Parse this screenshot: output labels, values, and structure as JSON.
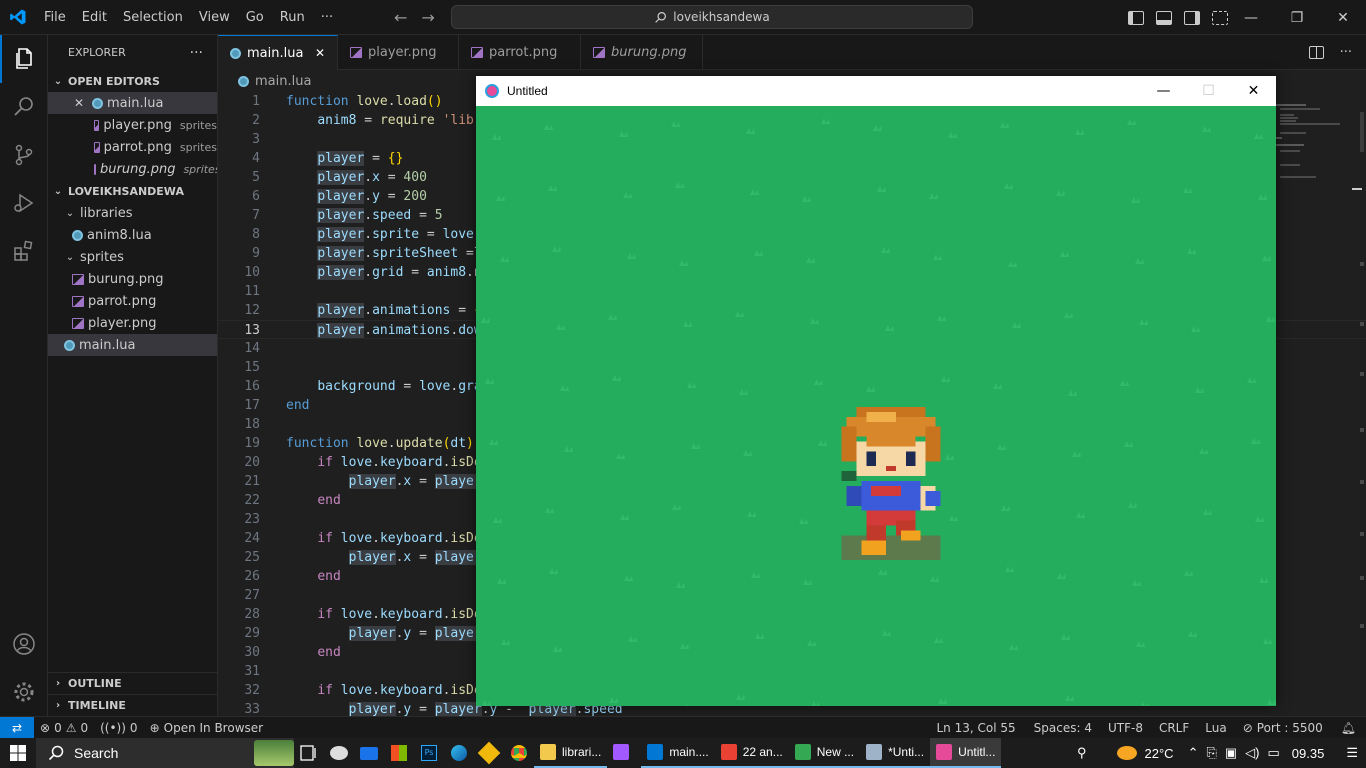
{
  "menu": [
    "File",
    "Edit",
    "Selection",
    "View",
    "Go",
    "Run",
    "···"
  ],
  "command_center": "loveikhsandewa",
  "explorer": {
    "title": "EXPLORER",
    "more": "···",
    "open_editors_label": "OPEN EDITORS",
    "open_editors": [
      {
        "label": "main.lua",
        "desc": "",
        "type": "lua",
        "close": "✕"
      },
      {
        "label": "player.png",
        "desc": "sprites",
        "type": "png"
      },
      {
        "label": "parrot.png",
        "desc": "sprites",
        "type": "png"
      },
      {
        "label": "burung.png",
        "desc": "sprites",
        "type": "png",
        "italic": true
      }
    ],
    "project_label": "LOVEIKHSANDEWA",
    "tree": [
      {
        "label": "libraries",
        "type": "folder"
      },
      {
        "label": "anim8.lua",
        "type": "lua"
      },
      {
        "label": "sprites",
        "type": "folder"
      },
      {
        "label": "burung.png",
        "type": "png"
      },
      {
        "label": "parrot.png",
        "type": "png"
      },
      {
        "label": "player.png",
        "type": "png"
      },
      {
        "label": "main.lua",
        "type": "lua"
      }
    ],
    "outline_label": "OUTLINE",
    "timeline_label": "TIMELINE"
  },
  "tabs": [
    {
      "label": "main.lua",
      "type": "lua",
      "close": "✕",
      "active": true
    },
    {
      "label": "player.png",
      "type": "png"
    },
    {
      "label": "parrot.png",
      "type": "png"
    },
    {
      "label": "burung.png",
      "type": "png",
      "italic": true
    }
  ],
  "breadcrumb": "main.lua",
  "code_lines": [
    {
      "n": 1,
      "html": "<span class='kb'>function</span> <span class='fn'>love</span>.<span class='fn'>load</span><span class='br'>()</span>"
    },
    {
      "n": 2,
      "html": "    <span class='var'>anim8</span> = <span class='fn'>require</span> <span class='str'>'libr</span>"
    },
    {
      "n": 3,
      "html": ""
    },
    {
      "n": 4,
      "html": "    <span class='var hl'>player</span> = <span class='br'>{}</span>"
    },
    {
      "n": 5,
      "html": "    <span class='var hl'>player</span>.<span class='var'>x</span> = <span class='num'>400</span>"
    },
    {
      "n": 6,
      "html": "    <span class='var hl'>player</span>.<span class='var'>y</span> = <span class='num'>200</span>"
    },
    {
      "n": 7,
      "html": "    <span class='var hl'>player</span>.<span class='var'>speed</span> = <span class='num'>5</span>"
    },
    {
      "n": 8,
      "html": "    <span class='var hl'>player</span>.<span class='var'>sprite</span> = <span class='var'>love</span>."
    },
    {
      "n": 9,
      "html": "    <span class='var hl'>player</span>.<span class='var'>spriteSheet</span> =l"
    },
    {
      "n": 10,
      "html": "    <span class='var hl'>player</span>.<span class='var'>grid</span> = <span class='var'>anim8</span>.n"
    },
    {
      "n": 11,
      "html": ""
    },
    {
      "n": 12,
      "html": "    <span class='var hl'>player</span>.<span class='var'>animations</span> = <span class='br'>{</span>"
    },
    {
      "n": 13,
      "html": "    <span class='var hl'>player</span>.<span class='var'>animations</span>.<span class='var'>dow</span>",
      "current": true
    },
    {
      "n": 14,
      "html": ""
    },
    {
      "n": 15,
      "html": ""
    },
    {
      "n": 16,
      "html": "    <span class='var'>background</span> = <span class='var'>love</span>.<span class='var'>gra</span>"
    },
    {
      "n": 17,
      "html": "<span class='kb'>end</span>"
    },
    {
      "n": 18,
      "html": ""
    },
    {
      "n": 19,
      "html": "<span class='kb'>function</span> <span class='fn'>love</span>.<span class='fn'>update</span><span class='br'>(</span><span class='var'>dt</span><span class='br'>)</span>"
    },
    {
      "n": 20,
      "html": "    <span class='kw'>if</span> <span class='var'>love</span>.<span class='var'>keyboard</span>.<span class='fn'>isDo</span>"
    },
    {
      "n": 21,
      "html": "        <span class='var hl'>player</span>.<span class='var'>x</span> = <span class='var hl'>player</span>"
    },
    {
      "n": 22,
      "html": "    <span class='kw'>end</span>"
    },
    {
      "n": 23,
      "html": ""
    },
    {
      "n": 24,
      "html": "    <span class='kw'>if</span> <span class='var'>love</span>.<span class='var'>keyboard</span>.<span class='fn'>isDo</span>"
    },
    {
      "n": 25,
      "html": "        <span class='var hl'>player</span>.<span class='var'>x</span> = <span class='var hl'>player</span>"
    },
    {
      "n": 26,
      "html": "    <span class='kw'>end</span>"
    },
    {
      "n": 27,
      "html": ""
    },
    {
      "n": 28,
      "html": "    <span class='kw'>if</span> <span class='var'>love</span>.<span class='var'>keyboard</span>.<span class='fn'>isDo</span>"
    },
    {
      "n": 29,
      "html": "        <span class='var hl'>player</span>.<span class='var'>y</span> = <span class='var hl'>player</span>"
    },
    {
      "n": 30,
      "html": "    <span class='kw'>end</span>"
    },
    {
      "n": 31,
      "html": ""
    },
    {
      "n": 32,
      "html": "    <span class='kw'>if</span> <span class='var'>love</span>.<span class='var'>keyboard</span>.<span class='fn'>isDo</span>"
    },
    {
      "n": 33,
      "html": "        <span class='var hl'>player</span>.<span class='var'>y</span> = <span class='var hl'>player</span>.<span class='var'>y</span> -  <span class='var hl'>player</span>.<span class='var'>speed</span>"
    }
  ],
  "love_window": {
    "title": "Untitled",
    "minimize": "—",
    "maximize": "☐",
    "close": "✕",
    "grass_color": "#24ad5c"
  },
  "status": {
    "remote": "⇄",
    "errors": "0",
    "warnings": "0",
    "ports": "0",
    "open_browser": "Open In Browser",
    "position": "Ln 13, Col 55",
    "spaces": "Spaces: 4",
    "encoding": "UTF-8",
    "eol": "CRLF",
    "language": "Lua",
    "port": "Port : 5500"
  },
  "taskbar": {
    "search_label": "Search",
    "apps": [
      {
        "label": "librari...",
        "color": "#f2c94c",
        "open": true
      },
      {
        "label": "",
        "color": "#a259ff",
        "open": false
      },
      {
        "label": "main....",
        "color": "#0078d4",
        "open": true
      },
      {
        "label": "22 an...",
        "color": "#e94235",
        "open": true
      },
      {
        "label": "New ...",
        "color": "#34a853",
        "open": true
      },
      {
        "label": "*Unti...",
        "color": "#9fb3c8",
        "open": true
      },
      {
        "label": "Untitl...",
        "color": "#e74a99",
        "open": true,
        "active": true
      }
    ],
    "weather": "22°C",
    "time": "09.35"
  }
}
